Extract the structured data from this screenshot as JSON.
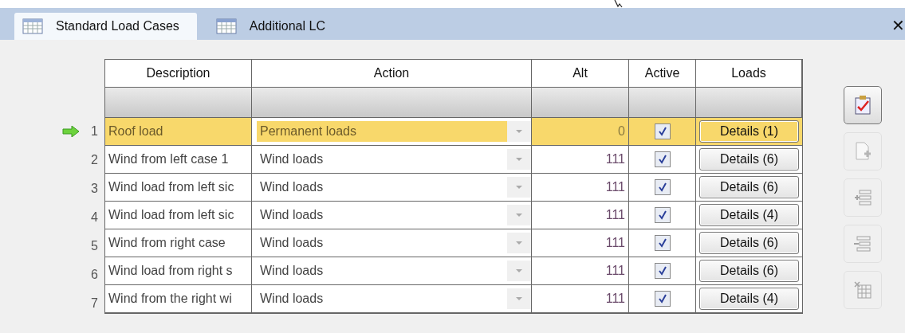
{
  "tabs": [
    {
      "label": "Standard Load Cases",
      "selected": true
    },
    {
      "label": "Additional LC",
      "selected": false
    }
  ],
  "table": {
    "columns": [
      "Description",
      "Action",
      "Alt",
      "Active",
      "Loads"
    ],
    "rows": [
      {
        "number": "1",
        "current": true,
        "selected": true,
        "description": "Roof load",
        "action": "Permanent loads",
        "alt": "0",
        "active": true,
        "loads": "Details (1)"
      },
      {
        "number": "2",
        "current": false,
        "selected": false,
        "description": "Wind from left case 1",
        "action": "Wind loads",
        "alt": "111",
        "active": true,
        "loads": "Details (6)"
      },
      {
        "number": "3",
        "current": false,
        "selected": false,
        "description": "Wind load from left sic",
        "action": "Wind loads",
        "alt": "111",
        "active": true,
        "loads": "Details (6)"
      },
      {
        "number": "4",
        "current": false,
        "selected": false,
        "description": "Wind load from left sic",
        "action": "Wind loads",
        "alt": "111",
        "active": true,
        "loads": "Details (4)"
      },
      {
        "number": "5",
        "current": false,
        "selected": false,
        "description": "Wind from right case",
        "action": "Wind loads",
        "alt": "111",
        "active": true,
        "loads": "Details (6)"
      },
      {
        "number": "6",
        "current": false,
        "selected": false,
        "description": "Wind load from right s",
        "action": "Wind loads",
        "alt": "111",
        "active": true,
        "loads": "Details (6)"
      },
      {
        "number": "7",
        "current": false,
        "selected": false,
        "description": "Wind from the right wi",
        "action": "Wind loads",
        "alt": "111",
        "active": true,
        "loads": "Details (4)"
      }
    ]
  },
  "close_button": "✕",
  "toolbar": [
    {
      "kind": "check",
      "disabled": false
    },
    {
      "kind": "new",
      "disabled": true
    },
    {
      "kind": "insert",
      "disabled": true
    },
    {
      "kind": "remove",
      "disabled": true
    },
    {
      "kind": "delete",
      "disabled": true
    }
  ]
}
